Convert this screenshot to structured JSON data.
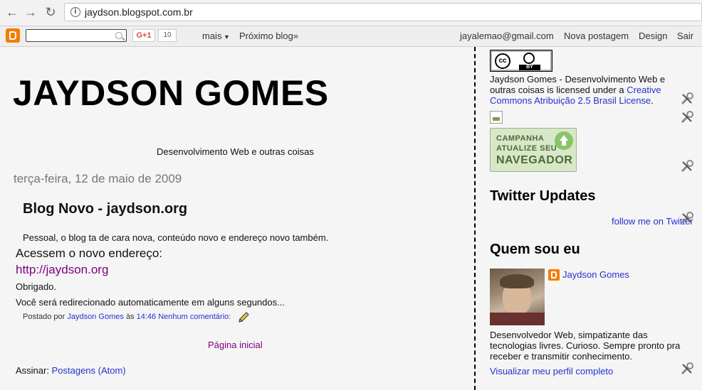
{
  "browser": {
    "url": "jaydson.blogspot.com.br"
  },
  "navbar": {
    "gplus_label": "G+1",
    "gplus_count": "10",
    "more_label": "mais",
    "next_blog_label": "Próximo blog»",
    "email": "jayalemao@gmail.com",
    "new_post_label": "Nova postagem",
    "design_label": "Design",
    "signout_label": "Sair"
  },
  "blog": {
    "title": "JAYDSON GOMES",
    "description": "Desenvolvimento Web e outras coisas"
  },
  "post": {
    "date": "terça-feira, 12 de maio de 2009",
    "title": "Blog Novo - jaydson.org",
    "line1": "Pessoal, o blog ta de cara nova, conteúdo novo e endereço novo também.",
    "line2": "Acessem o novo endereço:",
    "link": "http://jaydson.org",
    "line3": "Obrigado.",
    "line4": "Você será redirecionado automaticamente em alguns segundos...",
    "footer_prefix": "Postado por",
    "author": "Jaydson Gomes",
    "at": "às",
    "time": "14:46",
    "comments": "Nenhum comentário:"
  },
  "home_link": "Página inicial",
  "subscribe": {
    "label": "Assinar:",
    "link": "Postagens (Atom)"
  },
  "sidebar": {
    "cc_label": "BY",
    "license_text": "Jaydson Gomes - Desenvolvimento Web e outras coisas is licensed under a",
    "license_link": "Creative Commons Atribuição 2.5 Brasil License",
    "license_end": ".",
    "campanha_line1": "CAMPANHA",
    "campanha_line2": "ATUALIZE SEU",
    "campanha_line3": "NAVEGADOR",
    "twitter_title": "Twitter Updates",
    "follow_label": "follow me on Twitter",
    "about_title": "Quem sou eu",
    "profile_name": "Jaydson Gomes",
    "about_text": "Desenvolvedor Web, simpatizante das tecnologias livres. Curioso. Sempre pronto pra receber e transmitir conhecimento.",
    "view_profile": "Visualizar meu perfil completo"
  }
}
